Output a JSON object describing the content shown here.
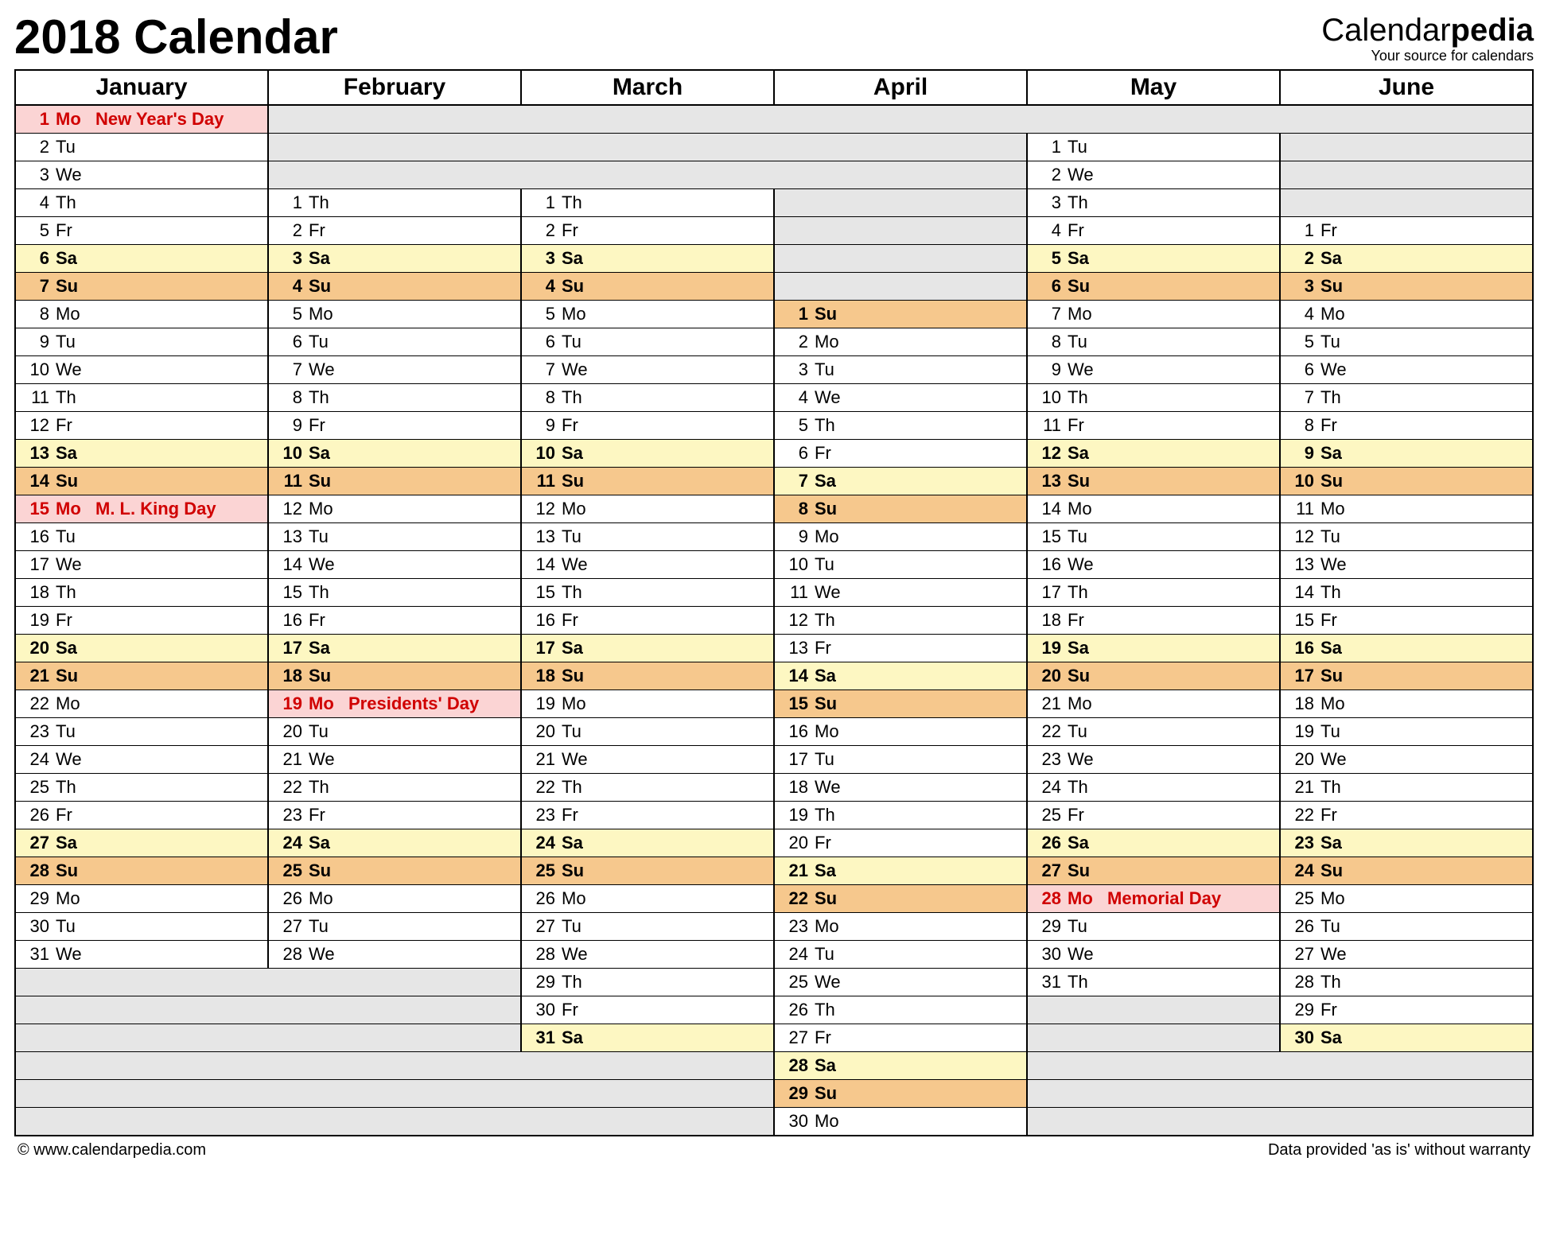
{
  "title": "2018 Calendar",
  "brand": {
    "name_plain": "Calendar",
    "name_bold": "pedia",
    "slogan": "Your source for calendars"
  },
  "footer": {
    "left": "© www.calendarpedia.com",
    "right": "Data provided 'as is' without warranty"
  },
  "months": [
    "January",
    "February",
    "March",
    "April",
    "May",
    "June"
  ],
  "rows": 37,
  "start_offsets": [
    0,
    3,
    3,
    7,
    1,
    4
  ],
  "month_lengths": [
    31,
    28,
    31,
    30,
    31,
    30
  ],
  "dow_for_jan1": 0,
  "dow_labels": [
    "Mo",
    "Tu",
    "We",
    "Th",
    "Fr",
    "Sa",
    "Su"
  ],
  "weekend_sat_idx": 5,
  "weekend_sun_idx": 6,
  "holidays": {
    "0": {
      "1": "New Year's Day",
      "15": "M. L. King Day"
    },
    "1": {
      "19": "Presidents' Day"
    },
    "4": {
      "28": "Memorial Day"
    }
  }
}
